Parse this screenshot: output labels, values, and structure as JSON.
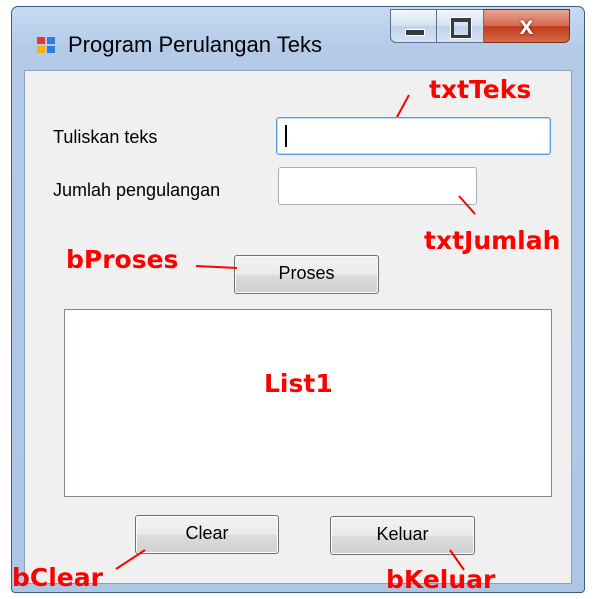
{
  "window": {
    "title": "Program Perulangan Teks",
    "controls": {
      "close": "x"
    }
  },
  "form": {
    "label_teks": "Tuliskan teks",
    "label_jumlah": "Jumlah pengulangan",
    "txtTeks_value": "",
    "txtJumlah_value": "",
    "button_proses": "Proses",
    "button_clear": "Clear",
    "button_keluar": "Keluar"
  },
  "annotations": {
    "txtTeks": "txtTeks",
    "txtJumlah": "txtJumlah",
    "bProses": "bProses",
    "list1": "List1",
    "bClear": "bClear",
    "bKeluar": "bKeluar"
  },
  "colors": {
    "annotation": "#ff0000",
    "close_button": "#c0391b",
    "window_frame": "#b4cbe8"
  }
}
